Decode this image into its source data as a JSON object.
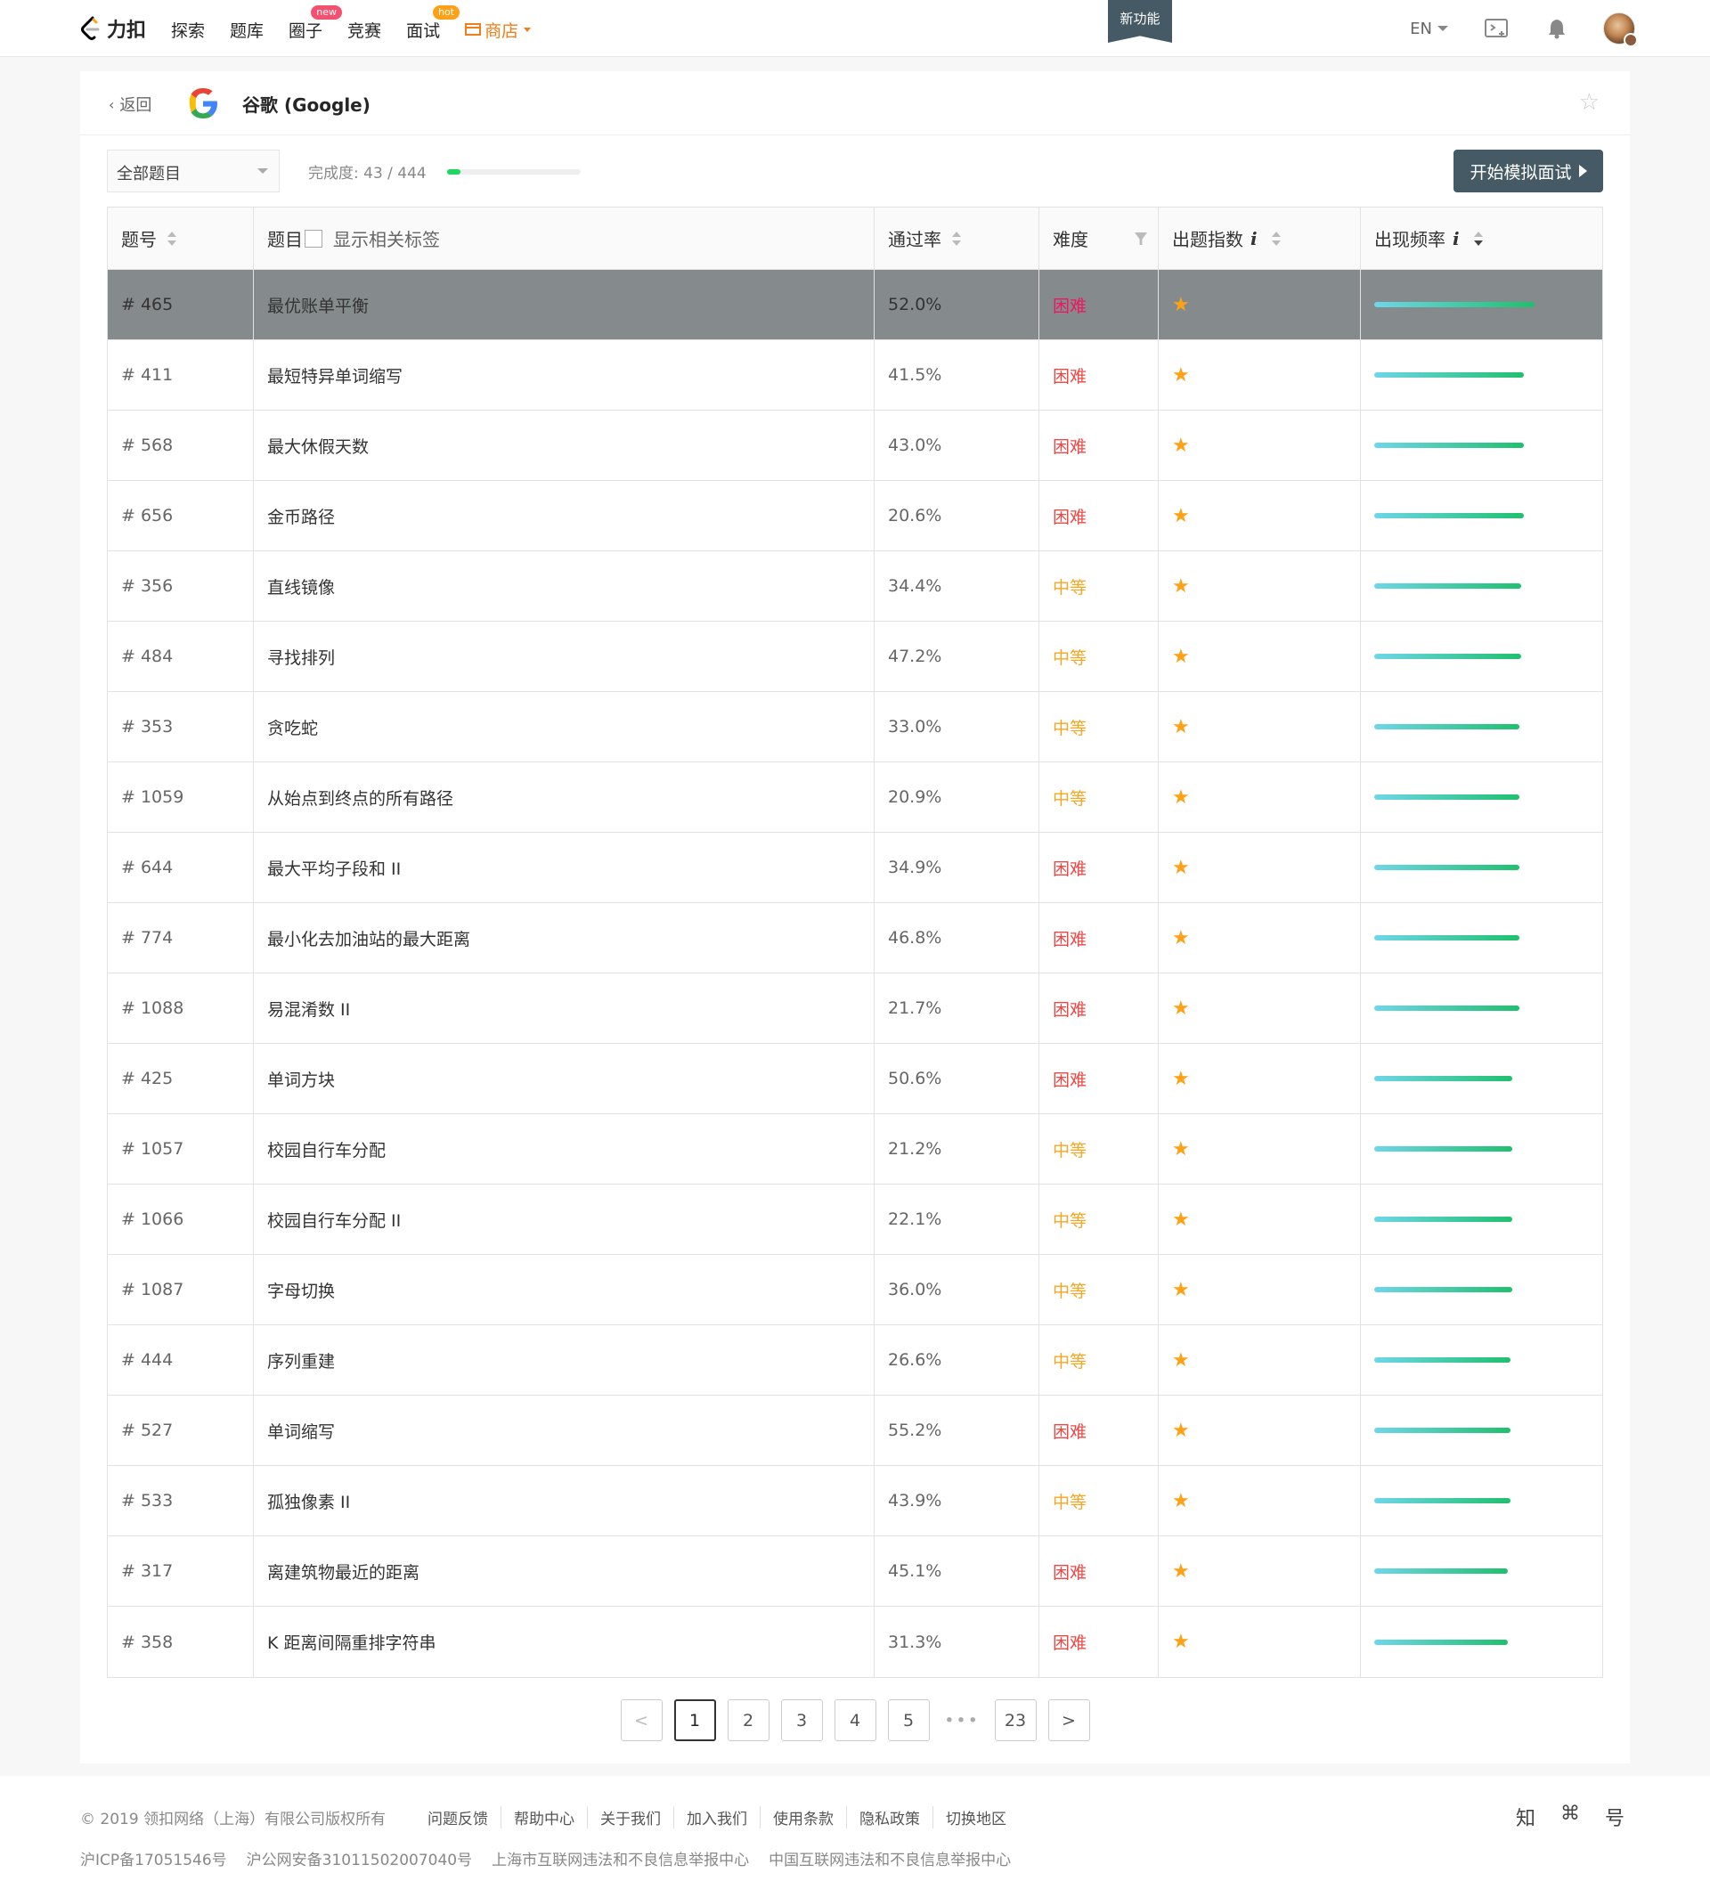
{
  "nav": {
    "brand": "力扣",
    "items": [
      {
        "label": "探索",
        "badge": ""
      },
      {
        "label": "题库",
        "badge": ""
      },
      {
        "label": "圈子",
        "badge": "new"
      },
      {
        "label": "竞赛",
        "badge": ""
      },
      {
        "label": "面试",
        "badge": "hot"
      }
    ],
    "store": "商店",
    "new_feature": "新功能",
    "lang": "EN",
    "icons": [
      "playground-icon",
      "bell-icon",
      "avatar"
    ]
  },
  "header": {
    "back": "返回",
    "company": "谷歌 (Google)"
  },
  "toolbar": {
    "filter": "全部题目",
    "progress_label": "完成度: 43 / 444",
    "progress_fraction": 0.0968,
    "mock_button": "开始模拟面试"
  },
  "table": {
    "headers": {
      "id": "题号",
      "title": "题目",
      "show_tags": "显示相关标签",
      "rate": "通过率",
      "difficulty": "难度",
      "index": "出题指数",
      "index_info": "i",
      "freq": "出现频率",
      "freq_info": "i"
    },
    "rows": [
      {
        "id": "# 465",
        "title": "最优账单平衡",
        "rate": "52.0%",
        "difficulty": "困难",
        "level": "hard",
        "freq": 0.72
      },
      {
        "id": "# 411",
        "title": "最短特异单词缩写",
        "rate": "41.5%",
        "difficulty": "困难",
        "level": "hard",
        "freq": 0.67
      },
      {
        "id": "# 568",
        "title": "最大休假天数",
        "rate": "43.0%",
        "difficulty": "困难",
        "level": "hard",
        "freq": 0.67
      },
      {
        "id": "# 656",
        "title": "金币路径",
        "rate": "20.6%",
        "difficulty": "困难",
        "level": "hard",
        "freq": 0.67
      },
      {
        "id": "# 356",
        "title": "直线镜像",
        "rate": "34.4%",
        "difficulty": "中等",
        "level": "mid",
        "freq": 0.66
      },
      {
        "id": "# 484",
        "title": "寻找排列",
        "rate": "47.2%",
        "difficulty": "中等",
        "level": "mid",
        "freq": 0.66
      },
      {
        "id": "# 353",
        "title": "贪吃蛇",
        "rate": "33.0%",
        "difficulty": "中等",
        "level": "mid",
        "freq": 0.65
      },
      {
        "id": "# 1059",
        "title": "从始点到终点的所有路径",
        "rate": "20.9%",
        "difficulty": "中等",
        "level": "mid",
        "freq": 0.65
      },
      {
        "id": "# 644",
        "title": "最大平均子段和 II",
        "rate": "34.9%",
        "difficulty": "困难",
        "level": "hard",
        "freq": 0.65
      },
      {
        "id": "# 774",
        "title": "最小化去加油站的最大距离",
        "rate": "46.8%",
        "difficulty": "困难",
        "level": "hard",
        "freq": 0.65
      },
      {
        "id": "# 1088",
        "title": "易混淆数 II",
        "rate": "21.7%",
        "difficulty": "困难",
        "level": "hard",
        "freq": 0.65
      },
      {
        "id": "# 425",
        "title": "单词方块",
        "rate": "50.6%",
        "difficulty": "困难",
        "level": "hard",
        "freq": 0.62
      },
      {
        "id": "# 1057",
        "title": "校园自行车分配",
        "rate": "21.2%",
        "difficulty": "中等",
        "level": "mid",
        "freq": 0.62
      },
      {
        "id": "# 1066",
        "title": "校园自行车分配 II",
        "rate": "22.1%",
        "difficulty": "中等",
        "level": "mid",
        "freq": 0.62
      },
      {
        "id": "# 1087",
        "title": "字母切换",
        "rate": "36.0%",
        "difficulty": "中等",
        "level": "mid",
        "freq": 0.62
      },
      {
        "id": "# 444",
        "title": "序列重建",
        "rate": "26.6%",
        "difficulty": "中等",
        "level": "mid",
        "freq": 0.61
      },
      {
        "id": "# 527",
        "title": "单词缩写",
        "rate": "55.2%",
        "difficulty": "困难",
        "level": "hard",
        "freq": 0.61
      },
      {
        "id": "# 533",
        "title": "孤独像素 II",
        "rate": "43.9%",
        "difficulty": "中等",
        "level": "mid",
        "freq": 0.61
      },
      {
        "id": "# 317",
        "title": "离建筑物最近的距离",
        "rate": "45.1%",
        "difficulty": "困难",
        "level": "hard",
        "freq": 0.6
      },
      {
        "id": "# 358",
        "title": "K 距离间隔重排字符串",
        "rate": "31.3%",
        "difficulty": "困难",
        "level": "hard",
        "freq": 0.6
      }
    ]
  },
  "pager": {
    "prev": "<",
    "pages": [
      "1",
      "2",
      "3",
      "4",
      "5"
    ],
    "ellipsis": "•••",
    "last": "23",
    "next": ">",
    "current": "1"
  },
  "footer": {
    "copyright": "© 2019 领扣网络（上海）有限公司版权所有",
    "links": [
      "问题反馈",
      "帮助中心",
      "关于我们",
      "加入我们",
      "使用条款",
      "隐私政策",
      "切换地区"
    ],
    "icp": [
      "沪ICP备17051546号",
      "沪公网安备31011502007040号",
      "上海市互联网违法和不良信息举报中心",
      "中国互联网违法和不良信息举报中心"
    ],
    "social": [
      "知",
      "⌘",
      "号"
    ]
  },
  "colors": {
    "accent": "#455a64",
    "hard": "#ef4743",
    "medium": "#f5a623",
    "star": "#ffa116",
    "progress": "#1ed760"
  }
}
